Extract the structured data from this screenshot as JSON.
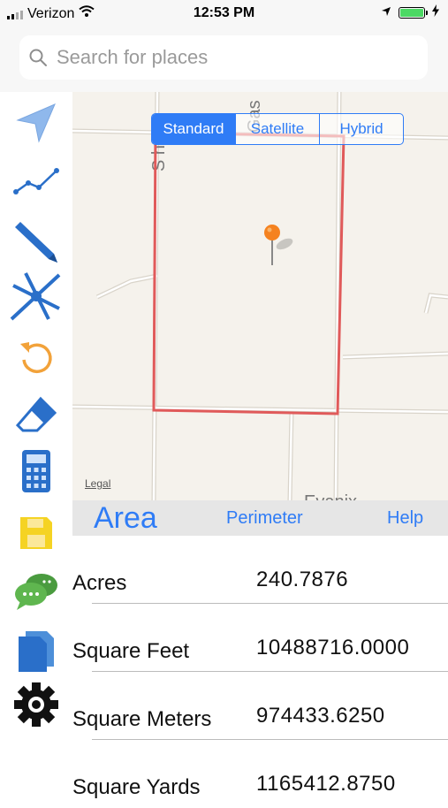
{
  "status_bar": {
    "carrier": "Verizon",
    "time": "12:53 PM"
  },
  "search": {
    "placeholder": "Search for places"
  },
  "sidebar": {
    "tools": [
      "location-arrow-icon",
      "line-graph-icon",
      "pencil-icon",
      "crosshair-icon",
      "undo-icon",
      "eraser-icon",
      "calculator-icon",
      "save-icon",
      "chat-icon",
      "document-icon",
      "settings-gear-icon"
    ]
  },
  "map": {
    "segments": [
      "Standard",
      "Satellite",
      "Hybrid"
    ],
    "selected_segment": "Standard",
    "legal": "Legal",
    "colors": {
      "boundary": "#e05a5a",
      "pin": "#f5821f",
      "accent": "#2f7cf6"
    }
  },
  "tabs": {
    "area": "Area",
    "perimeter": "Perimeter",
    "help": "Help"
  },
  "results": [
    {
      "unit": "Acres",
      "value": "240.7876"
    },
    {
      "unit": "Square Feet",
      "value": "10488716.0000"
    },
    {
      "unit": "Square Meters",
      "value": "974433.6250"
    },
    {
      "unit": "Square Yards",
      "value": "1165412.8750"
    }
  ]
}
